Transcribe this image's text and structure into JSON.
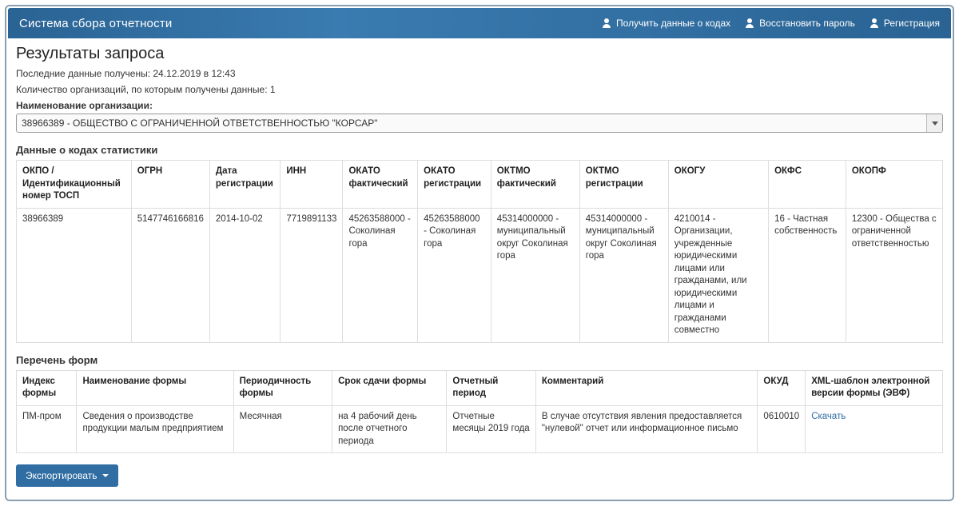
{
  "navbar": {
    "brand": "Система сбора отчетности",
    "links": {
      "codes": "Получить данные о кодах",
      "restore": "Восстановить пароль",
      "register": "Регистрация"
    }
  },
  "page": {
    "title": "Результаты запроса",
    "last_data": "Последние данные получены: 24.12.2019 в 12:43",
    "org_count": "Количество организаций, по которым получены данные: 1",
    "org_label": "Наименование организации:",
    "org_selected": "38966389 - ОБЩЕСТВО С ОГРАНИЧЕННОЙ ОТВЕТСТВЕННОСТЬЮ \"КОРСАР\""
  },
  "codes_section_title": "Данные о кодах статистики",
  "codes_table": {
    "headers": {
      "okpo": "ОКПО / Идентификационный номер ТОСП",
      "ogrn": "ОГРН",
      "reg_date": "Дата регистрации",
      "inn": "ИНН",
      "okato_fact": "ОКАТО фактический",
      "okato_reg": "ОКАТО регистрации",
      "oktmo_fact": "ОКТМО фактический",
      "oktmo_reg": "ОКТМО регистрации",
      "okogu": "ОКОГУ",
      "okfs": "ОКФС",
      "okopf": "ОКОПФ"
    },
    "row": {
      "okpo": "38966389",
      "ogrn": "5147746166816",
      "reg_date": "2014-10-02",
      "inn": "7719891133",
      "okato_fact": "45263588000 - Соколиная гора",
      "okato_reg": "45263588000 - Соколиная гора",
      "oktmo_fact": "45314000000 - муниципальный округ Соколиная гора",
      "oktmo_reg": "45314000000 - муниципальный округ Соколиная гора",
      "okogu": "4210014 - Организации, учрежденные юридическими лицами или гражданами, или юридическими лицами и гражданами совместно",
      "okfs": "16 - Частная собственность",
      "okopf": "12300 - Общества с ограниченной ответственностью"
    }
  },
  "forms_section_title": "Перечень форм",
  "forms_table": {
    "headers": {
      "index": "Индекс формы",
      "name": "Наименование формы",
      "period": "Периодичность формы",
      "deadline": "Срок сдачи формы",
      "report_period": "Отчетный период",
      "comment": "Комментарий",
      "okud": "ОКУД",
      "xml": "XML-шаблон электронной версии формы (ЭВФ)"
    },
    "row": {
      "index": "ПМ-пром",
      "name": "Сведения о производстве продукции малым предприятием",
      "period": "Месячная",
      "deadline": "на 4 рабочий день после отчетного периода",
      "report_period": "Отчетные месяцы 2019 года",
      "comment": "В случае отсутствия явления предоставляется \"нулевой\" отчет или информационное письмо",
      "okud": "0610010",
      "xml": "Скачать"
    }
  },
  "export_btn": "Экспортировать"
}
